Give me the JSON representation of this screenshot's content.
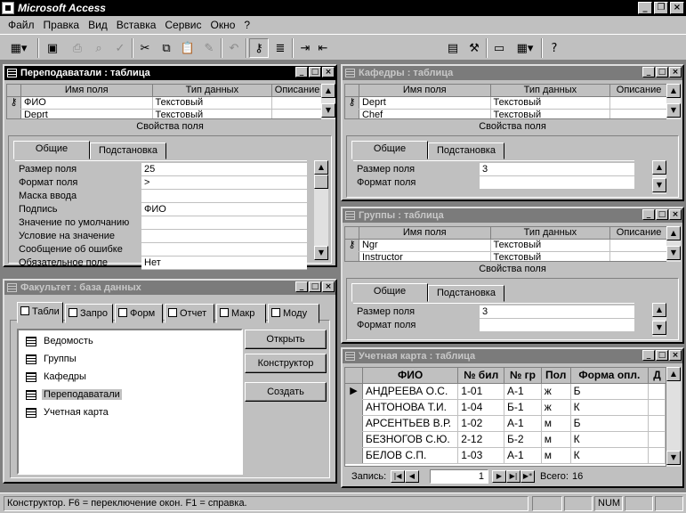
{
  "app": {
    "title": "Microsoft Access"
  },
  "menu": [
    "Файл",
    "Правка",
    "Вид",
    "Вставка",
    "Сервис",
    "Окно",
    "?"
  ],
  "prep": {
    "title": "Переподаватали : таблица",
    "cols": [
      "Имя поля",
      "Тип данных",
      "Описание"
    ],
    "rows": [
      [
        "ФИО",
        "Текстовый"
      ],
      [
        "Deprt",
        "Текстовый"
      ]
    ],
    "props_label": "Свойства поля",
    "tabs": [
      "Общие",
      "Подстановка"
    ],
    "props": [
      [
        "Размер поля",
        "25"
      ],
      [
        "Формат поля",
        ">"
      ],
      [
        "Маска ввода",
        ""
      ],
      [
        "Подпись",
        "ФИО"
      ],
      [
        "Значение по умолчанию",
        ""
      ],
      [
        "Условие на значение",
        ""
      ],
      [
        "Сообщение об ошибке",
        ""
      ],
      [
        "Обязательное поле",
        "Нет"
      ]
    ]
  },
  "kaf": {
    "title": "Кафедры : таблица",
    "cols": [
      "Имя поля",
      "Тип данных",
      "Описание"
    ],
    "rows": [
      [
        "Deprt",
        "Текстовый"
      ],
      [
        "Chef",
        "Текстовый"
      ]
    ],
    "props_label": "Свойства поля",
    "tabs": [
      "Общие",
      "Подстановка"
    ],
    "props": [
      [
        "Размер поля",
        "3"
      ],
      [
        "Формат поля",
        ""
      ]
    ]
  },
  "grp": {
    "title": "Группы : таблица",
    "cols": [
      "Имя поля",
      "Тип данных",
      "Описание"
    ],
    "rows": [
      [
        "Ngr",
        "Текстовый"
      ],
      [
        "Instructor",
        "Текстовый"
      ]
    ],
    "props_label": "Свойства поля",
    "tabs": [
      "Общие",
      "Подстановка"
    ],
    "props": [
      [
        "Размер поля",
        "3"
      ],
      [
        "Формат поля",
        ""
      ]
    ]
  },
  "db": {
    "title": "Факультет : база данных",
    "tabs": [
      "Табли",
      "Запро",
      "Форм",
      "Отчет",
      "Макр",
      "Моду"
    ],
    "items": [
      "Ведомость",
      "Группы",
      "Кафедры",
      "Переподаватали",
      "Учетная карта"
    ],
    "buttons": {
      "open": "Открыть",
      "design": "Конструктор",
      "create": "Создать"
    }
  },
  "uch": {
    "title": "Учетная карта : таблица",
    "cols": [
      "ФИО",
      "№ бил",
      "№ гр",
      "Пол",
      "Форма опл.",
      "Д"
    ],
    "rows": [
      [
        "АНДРЕЕВА О.С.",
        "1-01",
        "А-1",
        "ж",
        "Б"
      ],
      [
        "АНТОНОВА Т.И.",
        "1-04",
        "Б-1",
        "ж",
        "К"
      ],
      [
        "АРСЕНТЬЕВ В.Р.",
        "1-02",
        "А-1",
        "м",
        "Б"
      ],
      [
        "БЕЗНОГОВ С.Ю.",
        "2-12",
        "Б-2",
        "м",
        "К"
      ],
      [
        "БЕЛОВ С.П.",
        "1-03",
        "А-1",
        "м",
        "К"
      ]
    ],
    "nav": {
      "label": "Запись:",
      "current": "1",
      "total_label": "Всего:",
      "total": "16"
    }
  },
  "status": {
    "text": "Конструктор.  F6 = переключение окон.  F1 = справка.",
    "num": "NUM"
  }
}
